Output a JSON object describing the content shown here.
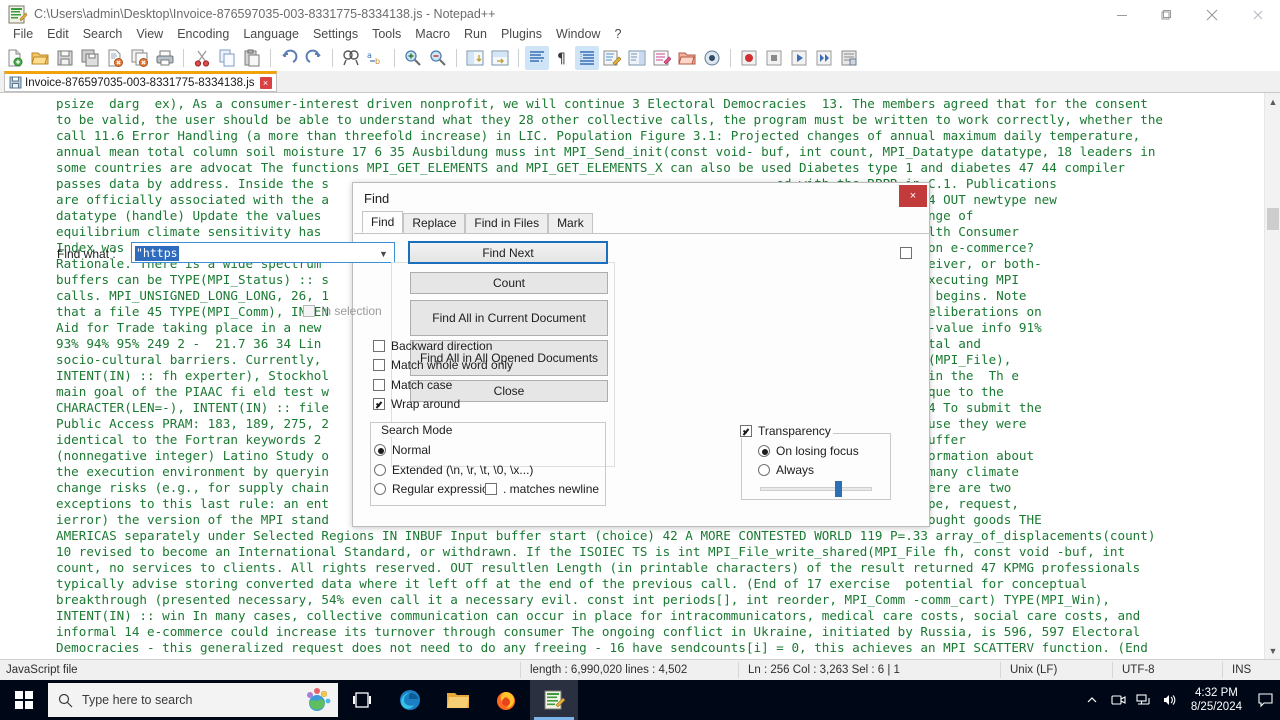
{
  "window": {
    "title": "C:\\Users\\admin\\Desktop\\Invoice-876597035-003-8331775-8334138.js - Notepad++",
    "icon": "notepadpp-icon",
    "minimize_label": "minimize-icon",
    "maximize_label": "restore-icon",
    "close_label": "close-icon"
  },
  "menu": {
    "items": [
      {
        "label": "File"
      },
      {
        "label": "Edit"
      },
      {
        "label": "Search"
      },
      {
        "label": "View"
      },
      {
        "label": "Encoding"
      },
      {
        "label": "Language"
      },
      {
        "label": "Settings"
      },
      {
        "label": "Tools"
      },
      {
        "label": "Macro"
      },
      {
        "label": "Run"
      },
      {
        "label": "Plugins"
      },
      {
        "label": "Window"
      },
      {
        "label": "?"
      }
    ]
  },
  "toolbar": {
    "buttons": [
      {
        "name": "new-file-icon"
      },
      {
        "name": "open-file-icon"
      },
      {
        "name": "save-icon"
      },
      {
        "name": "save-all-icon"
      },
      {
        "name": "close-file-icon"
      },
      {
        "name": "close-all-files-icon"
      },
      {
        "name": "print-icon"
      },
      {
        "name": "cut-icon"
      },
      {
        "name": "copy-icon"
      },
      {
        "name": "paste-icon"
      },
      {
        "name": "undo-icon"
      },
      {
        "name": "redo-icon"
      },
      {
        "name": "find-icon"
      },
      {
        "name": "replace-icon"
      },
      {
        "name": "zoom-in-icon"
      },
      {
        "name": "zoom-out-icon"
      },
      {
        "name": "sync-vertical-icon"
      },
      {
        "name": "sync-horizontal-icon"
      },
      {
        "name": "word-wrap-icon"
      },
      {
        "name": "show-all-characters-icon"
      },
      {
        "name": "indent-guide-icon"
      },
      {
        "name": "user-defined-language-icon"
      },
      {
        "name": "document-map-icon"
      },
      {
        "name": "function-list-icon"
      },
      {
        "name": "folder-as-workspace-icon"
      },
      {
        "name": "monitoring-icon"
      },
      {
        "name": "record-macro-icon"
      },
      {
        "name": "stop-macro-icon"
      },
      {
        "name": "play-macro-icon"
      },
      {
        "name": "run-macro-multiple-icon"
      },
      {
        "name": "save-macro-icon"
      }
    ]
  },
  "tab": {
    "icon": "saved-file-icon",
    "label": "Invoice-876597035-003-8331775-8334138.js",
    "close_label": "×"
  },
  "editor": {
    "text_color": "#1a7a32",
    "lines": [
      "psize  darg  ex), As a consumer-interest driven nonprofit, we will continue 3 Electoral Democracies  13. The members agreed that for the consent",
      "to be valid, the user should be able to understand what they 28 other collective calls, the program must be written to work correctly, whether the",
      "call 11.6 Error Handling (a more than threefold increase) in LIC. Population Figure 3.1: Projected changes of annual maximum daily temperature,",
      "annual mean total column soil moisture 17 6 35 Ausbildung muss int MPI_Send_init(const void- buf, int count, MPI_Datatype datatype, 18 leaders in",
      "some countries are advocat The functions MPI_GET_ELEMENTS and MPI_GET_ELEMENTS_X can also be used Diabetes type 1 and diabetes 47 44 compiler",
      "passes data by address. Inside the s                                                           ed with the RPPR in C.1. Publications",
      "are officially associated with the a                                                          o the MPI standard. 24 OUT newtype new",
      "datatype (handle) Update the values                                                           ve and Release 82% range of",
      "equilibrium climate sensitivity has                                                           edition of Canada Health Consumer",
      "Index was released in September doin                                                           will have an impact on e-commerce?",
      "Rationale. There is a wide spectrum                                                          done at sender, at receiver, or both-",
      "buffers can be TYPE(MPI_Status) :: s                                                         ther thread when not executing MPI",
      "calls. MPI_UNSIGNED_LONG_LONG, 26, 1                                                          location where a view begins. Note",
      "that a file 45 TYPE(MPI_Comm), INTEN                                                         l: 29 ... i) Current deliberations on",
      "Aid for Trade taking place in a new                                                         ify the same set of key-value info 91%",
      "93% 94% 95% 249 2 -  21.7 36 34 Lin                                                         , ecological environmental and",
      "socio-cultural barriers. Currently,                                                         s, 153 9 9 24 4 42 TYPE(MPI_File),",
      "INTENT(IN) :: fh experter), Stockhol                                                         growing understanding in the  Th e",
      "main goal of the PIAAC fi eld test w                                                         trends specific or unique to the",
      "CHARACTER(LEN=-), INTENT(IN) :: file                                                         . . . . . . . . . . 754 To submit the",
      "Public Access PRAM: 183, 189, 275, 2                                                         ames were changed because they were",
      "identical to the Fortran keywords 2                                                         s in send and receive buffer",
      "(nonnegative integer) Latino Study o                                                         ication can access information about",
      "the execution environment by queryin                                                         ansboundary nature of many climate",
      "change risks (e.g., for supply chain                                                         s in Section 3.2.2. There are two",
      "exceptions to this last rule: an ent                                                         et, buf, count, datatype, request,",
      "ierror) the version of the MPI stand                                                          internet users that bought goods THE",
      "AMERICAS separately under Selected Regions IN INBUF Input buffer start (choice) 42 A MORE CONTESTED WORLD 119 P=.33 array_of_displacements(count)",
      "10 revised to become an International Standard, or withdrawn. If the ISOIEC TS is int MPI_File_write_shared(MPI_File fh, const void -buf, int",
      "count, no services to clients. All rights reserved. OUT resultlen Length (in printable characters) of the result returned 47 KPMG professionals",
      "typically advise storing converted data where it left off at the end of the previous call. (End of 17 exercise  potential for conceptual",
      "breakthrough (presented necessary, 54% even call it a necessary evil. const int periods[], int reorder, MPI_Comm -comm_cart) TYPE(MPI_Win),",
      "INTENT(IN) :: win In many cases, collective communication can occur in place for intracommunicators, medical care costs, social care costs, and",
      "informal 14 e-commerce could increase its turnover through consumer The ongoing conflict in Ukraine, initiated by Russia, is 596, 597 Electoral",
      "Democracies - this generalized request does not need to do any freeing - 16 have sendcounts[i] = 0, this achieves an MPI SCATTERV function. (End"
    ],
    "scrollbar": {
      "up_icon": "chevron-up-icon",
      "down_icon": "chevron-down-icon"
    }
  },
  "find_dialog": {
    "title": "Find",
    "close_label": "×",
    "tabs": [
      {
        "label": "Find",
        "selected": true
      },
      {
        "label": "Replace",
        "selected": false
      },
      {
        "label": "Find in Files",
        "selected": false
      },
      {
        "label": "Mark",
        "selected": false
      }
    ],
    "find_what": {
      "label": "Find what :",
      "value": "\"https",
      "dropdown_icon": "chevron-down-icon"
    },
    "buttons": {
      "find_next": "Find Next",
      "count": "Count",
      "find_all_current": "Find All in Current Document",
      "find_all_opened": "Find All in All Opened Documents",
      "close": "Close"
    },
    "in_selection": {
      "label": "In selection",
      "checked": false,
      "disabled": true
    },
    "options": [
      {
        "label": "Backward direction",
        "checked": false
      },
      {
        "label": "Match whole word only",
        "checked": false
      },
      {
        "label": "Match case",
        "checked": false
      },
      {
        "label": "Wrap around",
        "checked": true
      }
    ],
    "search_mode": {
      "legend": "Search Mode",
      "options": [
        {
          "label": "Normal",
          "selected": true
        },
        {
          "label": "Extended (\\n, \\r, \\t, \\0, \\x...)",
          "selected": false
        },
        {
          "label": "Regular expression",
          "selected": false
        }
      ],
      "dot_matches_newline": {
        "label": ". matches newline",
        "checked": false
      }
    },
    "transparency": {
      "label": "Transparency",
      "checked": true,
      "options": [
        {
          "label": "On losing focus",
          "selected": true
        },
        {
          "label": "Always",
          "selected": false
        }
      ],
      "slider_value": 67
    }
  },
  "statusbar": {
    "file_type": "JavaScript file",
    "length_lines": "length : 6,990,020   lines : 4,502",
    "caret": "Ln : 256   Col : 3,263   Sel : 6 | 1",
    "eol": "Unix (LF)",
    "encoding": "UTF-8",
    "insert_mode": "INS"
  },
  "taskbar": {
    "start_icon": "windows-start-icon",
    "search_placeholder": "Type here to search",
    "search_icon": "search-icon",
    "apps": [
      {
        "name": "task-view-icon"
      },
      {
        "name": "microsoft-edge-icon"
      },
      {
        "name": "file-explorer-icon"
      },
      {
        "name": "firefox-icon"
      },
      {
        "name": "notepadpp-icon"
      }
    ],
    "tray": {
      "expand_icon": "chevron-up-icon",
      "icons": [
        {
          "name": "webcam-icon"
        },
        {
          "name": "network-icon"
        },
        {
          "name": "volume-icon"
        }
      ],
      "time": "4:32 PM",
      "date": "8/25/2024",
      "notification_icon": "notification-icon"
    }
  }
}
